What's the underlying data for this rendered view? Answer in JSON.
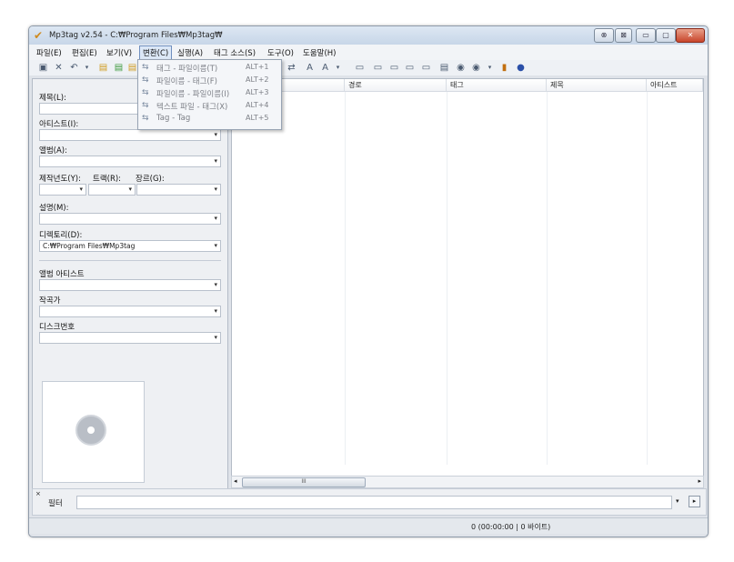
{
  "window": {
    "title": "Mp3tag v2.54  -  C:₩Program Files₩Mp3tag₩"
  },
  "titlebar_buttons": [
    "⊗",
    "⊠",
    "▭",
    "▢",
    "✕"
  ],
  "menu": [
    "파일(E)",
    "편집(E)",
    "보기(V)",
    "변환(C)",
    "실행(A)",
    "태그 소스(S)",
    "도구(O)",
    "도움말(H)"
  ],
  "convert_menu": [
    {
      "label": "태그 - 파일이름(T)",
      "shortcut": "ALT+1"
    },
    {
      "label": "파일이름 - 태그(F)",
      "shortcut": "ALT+2"
    },
    {
      "label": "파일이름 - 파일이름(I)",
      "shortcut": "ALT+3"
    },
    {
      "label": "텍스트 파일 - 태그(X)",
      "shortcut": "ALT+4"
    },
    {
      "label": "Tag - Tag",
      "shortcut": "ALT+5"
    }
  ],
  "tag_panel": {
    "title_label": "제목(L):",
    "artist_label": "아티스트(I):",
    "album_label": "앨범(A):",
    "year_label": "제작년도(Y):",
    "track_label": "트랙(R):",
    "genre_label": "장르(G):",
    "comment_label": "설명(M):",
    "directory_label": "디렉토리(D):",
    "directory_value": "C:₩Program Files₩Mp3tag",
    "album_artist_label": "앨범 아티스트",
    "composer_label": "작곡가",
    "discnumber_label": "디스크번호"
  },
  "columns": [
    "경로",
    "태그",
    "제목",
    "아티스트"
  ],
  "hscroll_grip": "III",
  "filter": {
    "label": "필터"
  },
  "status": {
    "text": "0 (00:00:00 | 0 바이트)"
  }
}
